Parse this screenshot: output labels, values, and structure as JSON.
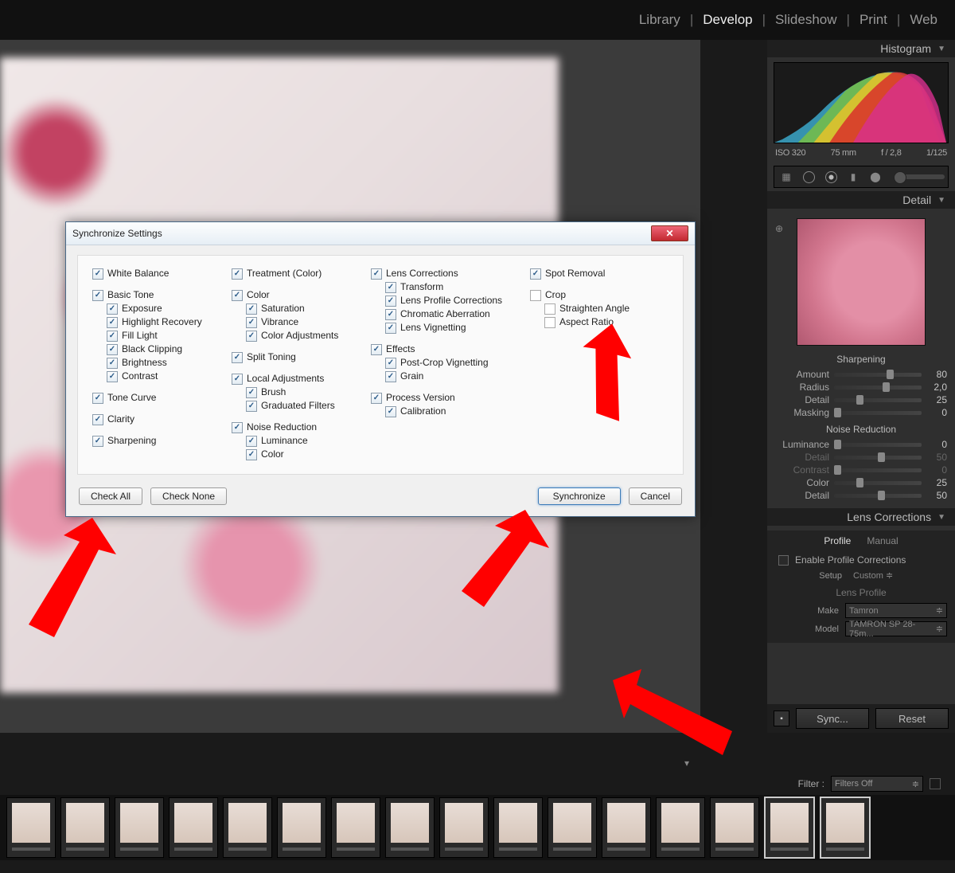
{
  "nav": {
    "library": "Library",
    "develop": "Develop",
    "slideshow": "Slideshow",
    "print": "Print",
    "web": "Web"
  },
  "histogram": {
    "title": "Histogram",
    "iso": "ISO 320",
    "focal": "75 mm",
    "aperture": "f / 2,8",
    "shutter": "1/125"
  },
  "detail": {
    "title": "Detail",
    "sharpening": "Sharpening",
    "sharp": [
      {
        "l": "Amount",
        "v": "80",
        "p": 60
      },
      {
        "l": "Radius",
        "v": "2,0",
        "p": 55
      },
      {
        "l": "Detail",
        "v": "25",
        "p": 25
      },
      {
        "l": "Masking",
        "v": "0",
        "p": 0
      }
    ],
    "nr_title": "Noise Reduction",
    "nr": [
      {
        "l": "Luminance",
        "v": "0",
        "p": 0,
        "dim": false
      },
      {
        "l": "Detail",
        "v": "50",
        "p": 50,
        "dim": true
      },
      {
        "l": "Contrast",
        "v": "0",
        "p": 0,
        "dim": true
      },
      {
        "l": "Color",
        "v": "25",
        "p": 25,
        "dim": false
      },
      {
        "l": "Detail",
        "v": "50",
        "p": 50,
        "dim": false
      }
    ]
  },
  "lens": {
    "title": "Lens Corrections",
    "tabs": {
      "profile": "Profile",
      "manual": "Manual"
    },
    "enable": "Enable Profile Corrections",
    "setup_l": "Setup",
    "setup_v": "Custom",
    "profile_l": "Lens Profile",
    "make_l": "Make",
    "make_v": "Tamron",
    "model_l": "Model",
    "model_v": "TAMRON SP 28-75m..."
  },
  "buttons": {
    "sync": "Sync...",
    "reset": "Reset"
  },
  "filter": {
    "label": "Filter :",
    "value": "Filters Off"
  },
  "dialog": {
    "title": "Synchronize Settings",
    "col1": [
      {
        "label": "White Balance",
        "c": true,
        "sub": []
      },
      {
        "label": "Basic Tone",
        "c": true,
        "sub": [
          {
            "label": "Exposure",
            "c": true
          },
          {
            "label": "Highlight Recovery",
            "c": true
          },
          {
            "label": "Fill Light",
            "c": true
          },
          {
            "label": "Black Clipping",
            "c": true
          },
          {
            "label": "Brightness",
            "c": true
          },
          {
            "label": "Contrast",
            "c": true
          }
        ]
      },
      {
        "label": "Tone Curve",
        "c": true,
        "sub": []
      },
      {
        "label": "Clarity",
        "c": true,
        "sub": []
      },
      {
        "label": "Sharpening",
        "c": true,
        "sub": []
      }
    ],
    "col2": [
      {
        "label": "Treatment (Color)",
        "c": true,
        "sub": []
      },
      {
        "label": "Color",
        "c": true,
        "sub": [
          {
            "label": "Saturation",
            "c": true
          },
          {
            "label": "Vibrance",
            "c": true
          },
          {
            "label": "Color Adjustments",
            "c": true
          }
        ]
      },
      {
        "label": "Split Toning",
        "c": true,
        "sub": []
      },
      {
        "label": "Local Adjustments",
        "c": true,
        "sub": [
          {
            "label": "Brush",
            "c": true
          },
          {
            "label": "Graduated Filters",
            "c": true
          }
        ]
      },
      {
        "label": "Noise Reduction",
        "c": true,
        "sub": [
          {
            "label": "Luminance",
            "c": true
          },
          {
            "label": "Color",
            "c": true
          }
        ]
      }
    ],
    "col3": [
      {
        "label": "Lens Corrections",
        "c": true,
        "sub": [
          {
            "label": "Transform",
            "c": true
          },
          {
            "label": "Lens Profile Corrections",
            "c": true
          },
          {
            "label": "Chromatic Aberration",
            "c": true
          },
          {
            "label": "Lens Vignetting",
            "c": true
          }
        ]
      },
      {
        "label": "Effects",
        "c": true,
        "sub": [
          {
            "label": "Post-Crop Vignetting",
            "c": true
          },
          {
            "label": "Grain",
            "c": true
          }
        ]
      },
      {
        "label": "Process Version",
        "c": true,
        "sub": [
          {
            "label": "Calibration",
            "c": true
          }
        ]
      }
    ],
    "col4": [
      {
        "label": "Spot Removal",
        "c": true,
        "sub": []
      },
      {
        "label": "Crop",
        "c": false,
        "sub": [
          {
            "label": "Straighten Angle",
            "c": false
          },
          {
            "label": "Aspect Ratio",
            "c": false
          }
        ]
      }
    ],
    "check_all": "Check All",
    "check_none": "Check None",
    "synchronize": "Synchronize",
    "cancel": "Cancel"
  }
}
